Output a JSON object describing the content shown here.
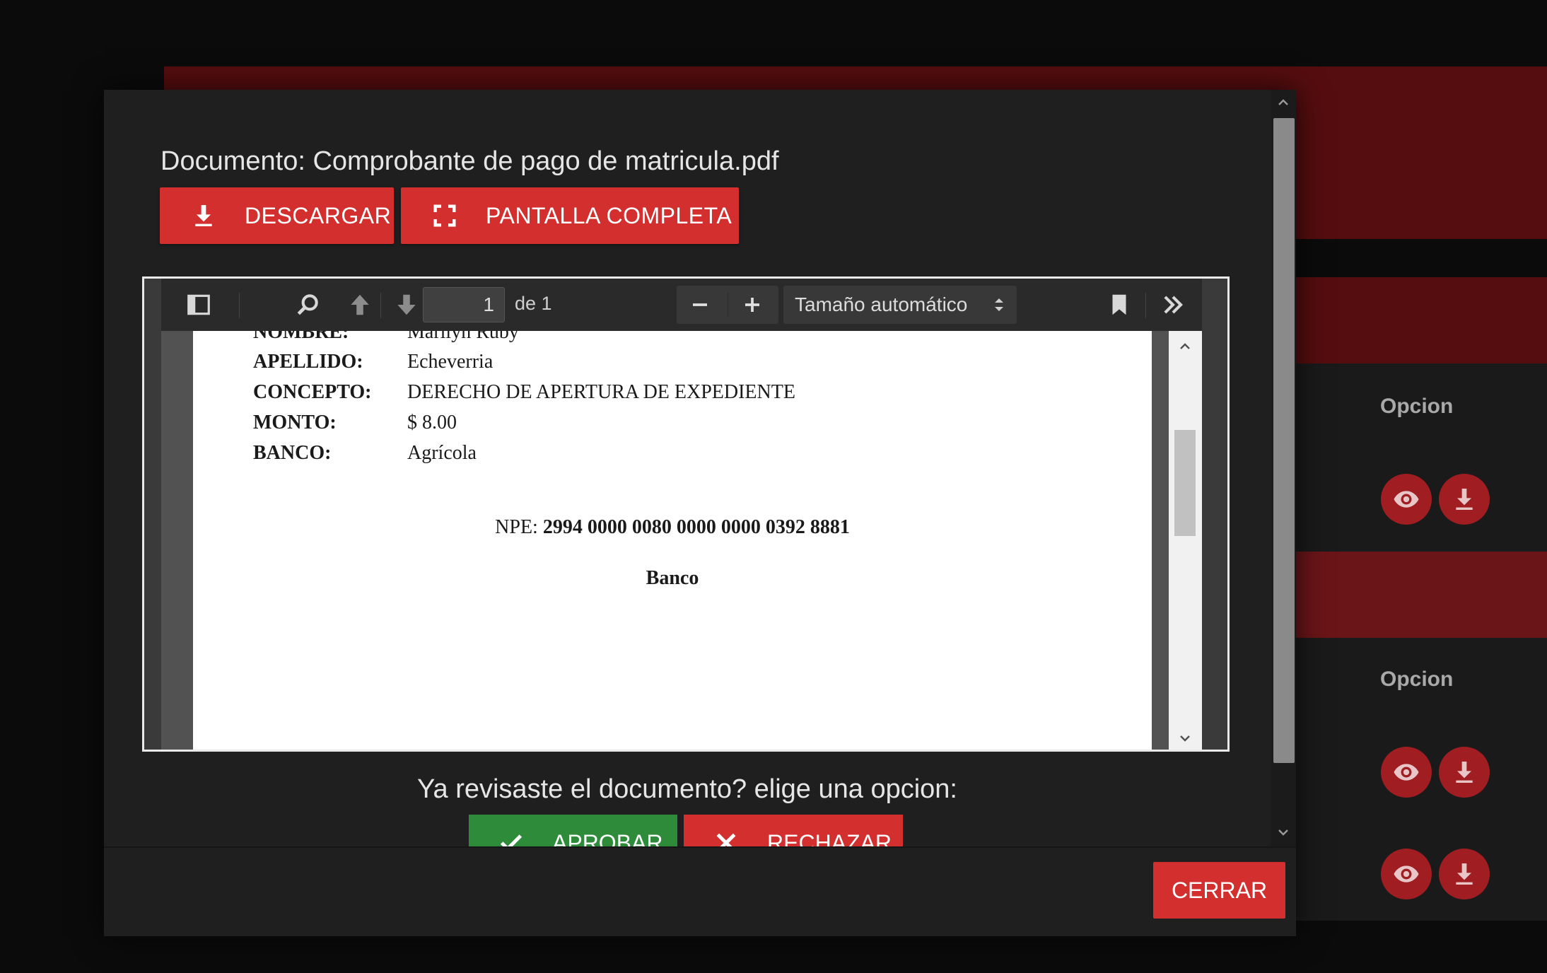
{
  "background": {
    "option_headers": [
      "Opcion",
      "Opcion"
    ],
    "action_icons": [
      "eye-icon",
      "download-icon"
    ],
    "colors": {
      "band": "#560d0f",
      "round_button": "#a01d22"
    }
  },
  "modal": {
    "title": "Documento: Comprobante de pago de matricula.pdf",
    "download_label": "DESCARGAR",
    "fullscreen_label": "PANTALLA COMPLETA",
    "question": "Ya revisaste el documento? elige una opcion:",
    "approve_label": "APROBAR",
    "reject_label": "RECHAZAR",
    "close_label": "CERRAR",
    "colors": {
      "primary": "#d32f2f",
      "success": "#2e8b3a",
      "surface": "#1f1f1f"
    }
  },
  "viewer": {
    "page_number": "1",
    "page_of": "de 1",
    "zoom": "Tamaño automático",
    "zoom_out": "−",
    "zoom_in": "+"
  },
  "pdf": {
    "fields": [
      {
        "key": "NOMBRE:",
        "value": "Marilyn Ruby"
      },
      {
        "key": "APELLIDO:",
        "value": "Echeverria"
      },
      {
        "key": "CONCEPTO:",
        "value": "DERECHO DE APERTURA DE EXPEDIENTE"
      },
      {
        "key": "MONTO:",
        "value": "$ 8.00"
      },
      {
        "key": "BANCO:",
        "value": "Agrícola"
      }
    ],
    "npe_label": "NPE: ",
    "npe_value": "2994 0000 0080 0000 0000 0392 8881",
    "bank_heading": "Banco"
  }
}
